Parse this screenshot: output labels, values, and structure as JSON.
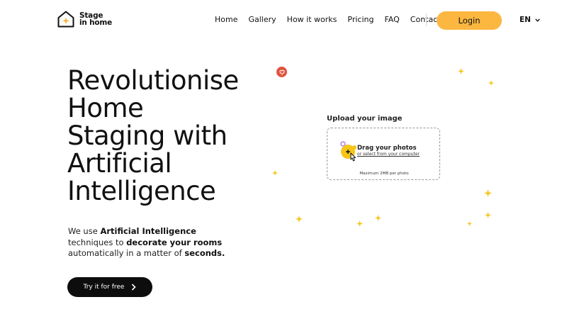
{
  "header": {
    "logo": {
      "line1": "Stage",
      "line2": "in home"
    },
    "nav": [
      {
        "label": "Home"
      },
      {
        "label": "Gallery"
      },
      {
        "label": "How it works"
      },
      {
        "label": "Pricing"
      },
      {
        "label": "FAQ"
      },
      {
        "label": "Contact"
      }
    ],
    "login_label": "Login",
    "language": "EN"
  },
  "hero": {
    "title_lines": [
      "Revolutionise",
      "Home",
      "Staging with",
      "Artificial",
      "Intelligence"
    ],
    "description": {
      "p1": "We use ",
      "b1": "Artificial Intelligence",
      "p2": " techniques to ",
      "b2": "decorate your rooms",
      "p3": " automatically in a matter of ",
      "b3": "seconds."
    },
    "cta_label": "Try it for free"
  },
  "upload": {
    "label": "Upload your image",
    "main_text": "Drag your photos",
    "sub_text": "or select from your computer",
    "max_text": "Maximum 2MB per photo"
  },
  "colors": {
    "accent": "#fbb740",
    "sparkle": "#f5c518",
    "heart_badge": "#e0553f",
    "cta_bg": "#0d0d0d"
  },
  "icons": {
    "logo": "house-sparkle-icon",
    "language_caret": "chevron-down-icon",
    "cta_arrow": "chevron-right-icon",
    "badge": "heart-icon",
    "upload": "add-photo-hand-icon",
    "decoration": "sparkle-icon"
  }
}
